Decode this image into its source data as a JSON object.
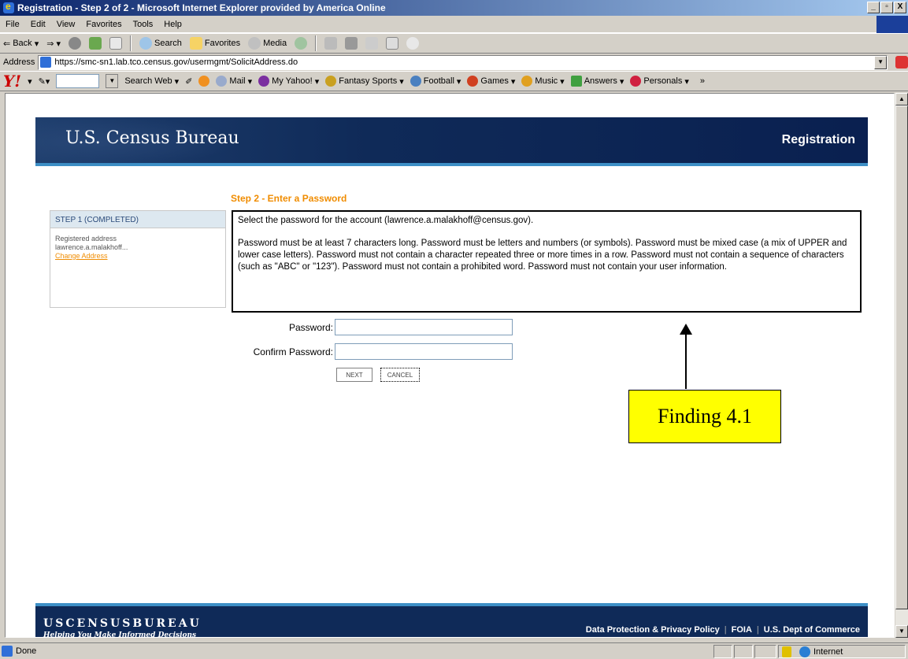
{
  "window": {
    "title": "Registration - Step 2 of 2 - Microsoft Internet Explorer provided by America Online",
    "buttons": [
      "_",
      "▫",
      "X"
    ]
  },
  "menu": [
    "File",
    "Edit",
    "View",
    "Favorites",
    "Tools",
    "Help"
  ],
  "toolbar": {
    "back": "Back",
    "search": "Search",
    "favorites": "Favorites",
    "media": "Media"
  },
  "address": {
    "label": "Address",
    "url": "https://smc-sn1.lab.tco.census.gov/usermgmt/SolicitAddress.do"
  },
  "yahoo": {
    "search_web": "Search Web",
    "items": [
      "Mail",
      "My Yahoo!",
      "Fantasy Sports",
      "Football",
      "Games",
      "Music",
      "Answers",
      "Personals"
    ]
  },
  "page": {
    "brand_title": "U.S. Census Bureau",
    "section": "Registration",
    "step_title": "Step 2 - Enter a Password",
    "sidebar": {
      "head": "STEP 1 (COMPLETED)",
      "line1": "Registered address",
      "line2": "lawrence.a.malakhoff...",
      "link": "Change Address"
    },
    "info_select": "Select the password for the account (lawrence.a.malakhoff@census.gov).",
    "info_rules": "Password must be at least 7 characters long. Password must be letters and numbers (or symbols). Password must be mixed case (a mix of UPPER and lower case letters). Password must not contain a character repeated three or more times in a row. Password must not contain a sequence of characters (such as \"ABC\" or \"123\"). Password must not contain a prohibited word. Password must not contain your user information.",
    "password_label": "Password:",
    "confirm_label": "Confirm Password:",
    "next": "NEXT",
    "cancel": "CANCEL",
    "annotation": "Finding 4.1",
    "footer": {
      "brand": "USCENSUSBUREAU",
      "tagline": "Helping You Make Informed Decisions",
      "link_privacy": "Data Protection & Privacy Policy",
      "link_foia": "FOIA",
      "link_commerce": "U.S. Dept of Commerce"
    }
  },
  "status": {
    "text": "Done",
    "zone": "Internet"
  }
}
